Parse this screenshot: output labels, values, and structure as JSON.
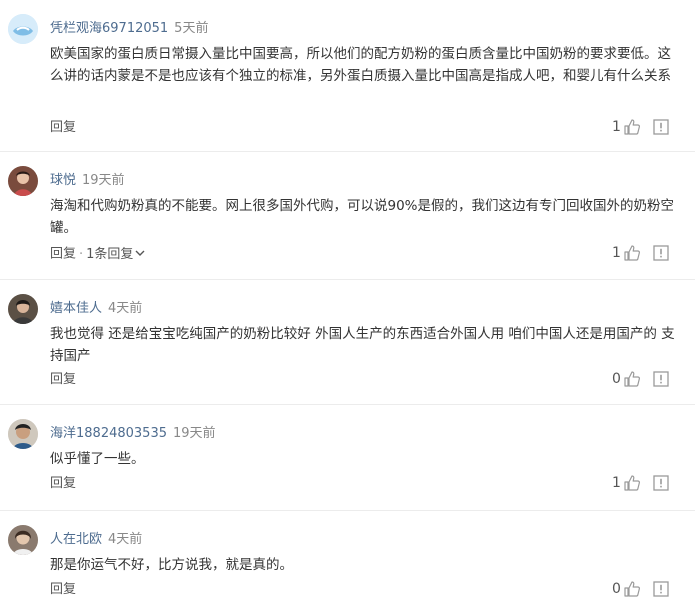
{
  "comments": [
    {
      "user": "凭栏观海69712051",
      "time": "5天前",
      "avatar": "default-avatar-icon",
      "content": "欧美国家的蛋白质日常摄入量比中国要高，所以他们的配方奶粉的蛋白质含量比中国奶粉的要求要低。这么讲的话内蒙是不是也应该有个独立的标准，另外蛋白质摄入量比中国高是指成人吧，和婴儿有什么关系",
      "reply_label": "回复",
      "likes": "1"
    },
    {
      "user": "球悦",
      "time": "19天前",
      "avatar": "user-photo-avatar",
      "content": "海淘和代购奶粉真的不能要。网上很多国外代购，可以说90%是假的，我们这边有专门回收国外的奶粉空罐。",
      "reply_label": "回复",
      "replies_label": "1条回复",
      "likes": "1"
    },
    {
      "user": "嬉本佳人",
      "time": "4天前",
      "avatar": "user-photo-avatar",
      "content": "我也觉得 还是给宝宝吃纯国产的奶粉比较好 外国人生产的东西适合外国人用 咱们中国人还是用国产的 支持国产",
      "reply_label": "回复",
      "likes": "0"
    },
    {
      "user": "海洋18824803535",
      "time": "19天前",
      "avatar": "user-photo-avatar",
      "content": "似乎懂了一些。",
      "reply_label": "回复",
      "likes": "1"
    },
    {
      "user": "人在北欧",
      "time": "4天前",
      "avatar": "user-photo-avatar",
      "content": "那是你运气不好，比方说我，就是真的。",
      "reply_label": "回复",
      "likes": "0"
    }
  ],
  "colors": {
    "username": "#4e6c8f",
    "time": "#888888",
    "text": "#333333",
    "icon": "#9a9a9a"
  }
}
